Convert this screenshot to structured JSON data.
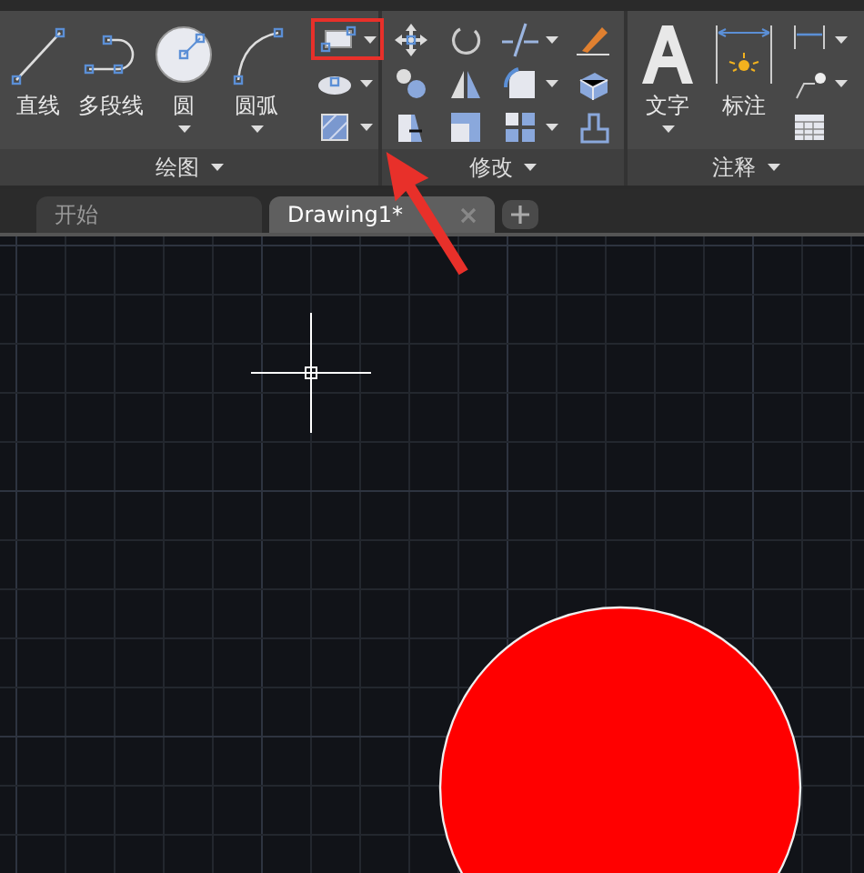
{
  "ribbon": {
    "panels": [
      {
        "title": "绘图",
        "large_tools": [
          {
            "label": "直线",
            "kind": "line",
            "dropdown": false
          },
          {
            "label": "多段线",
            "kind": "polyline",
            "dropdown": false
          },
          {
            "label": "圆",
            "kind": "circle",
            "dropdown": true
          },
          {
            "label": "圆弧",
            "kind": "arc",
            "dropdown": true
          }
        ],
        "small_columns": [
          [
            {
              "kind": "rectangle",
              "dropdown": true,
              "highlighted": true
            },
            {
              "kind": "ellipse",
              "dropdown": true
            },
            {
              "kind": "hatch",
              "dropdown": true
            }
          ]
        ]
      },
      {
        "title": "修改",
        "small_columns": [
          [
            {
              "kind": "move",
              "dropdown": false
            },
            {
              "kind": "copy",
              "dropdown": false
            },
            {
              "kind": "stretch",
              "dropdown": false
            }
          ],
          [
            {
              "kind": "rotate",
              "dropdown": false
            },
            {
              "kind": "mirror",
              "dropdown": false
            },
            {
              "kind": "scale",
              "dropdown": false
            }
          ],
          [
            {
              "kind": "trim",
              "dropdown": true
            },
            {
              "kind": "fillet",
              "dropdown": true
            },
            {
              "kind": "array",
              "dropdown": true
            }
          ],
          [
            {
              "kind": "erase",
              "dropdown": false
            },
            {
              "kind": "explode",
              "dropdown": false
            },
            {
              "kind": "offset",
              "dropdown": false
            }
          ]
        ]
      },
      {
        "title": "注释",
        "large_tools": [
          {
            "label": "文字",
            "kind": "text",
            "dropdown": true
          },
          {
            "label": "标注",
            "kind": "dimension",
            "dropdown": false
          }
        ],
        "small_columns": [
          [
            {
              "kind": "linear",
              "dropdown": true
            },
            {
              "kind": "leader",
              "dropdown": true
            },
            {
              "kind": "table",
              "dropdown": false
            }
          ]
        ]
      }
    ]
  },
  "file_tabs": [
    {
      "label": "开始",
      "selected": false,
      "closable": false
    },
    {
      "label": "Drawing1*",
      "selected": true,
      "closable": true
    }
  ]
}
